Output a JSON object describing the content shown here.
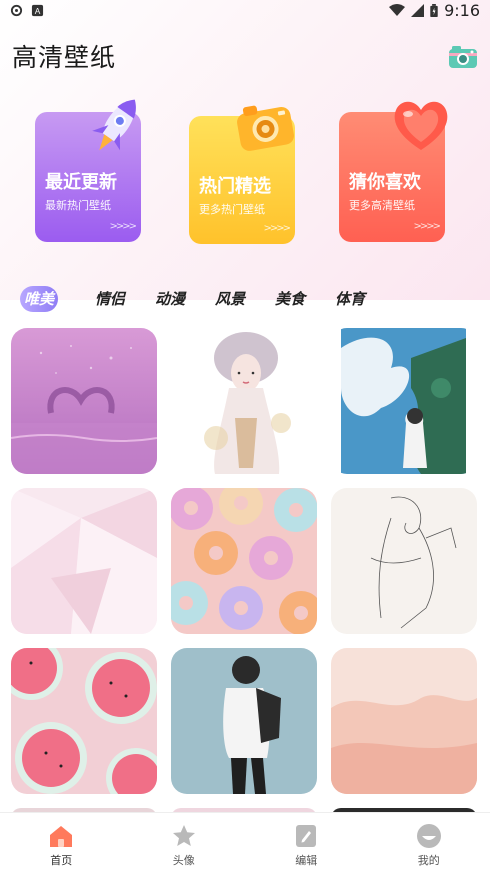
{
  "status_bar": {
    "time": "9:16",
    "left_icons": [
      "settings-icon",
      "app-a-icon"
    ],
    "right_icons": [
      "wifi-icon",
      "signal-icon",
      "battery-icon"
    ]
  },
  "header": {
    "title": "高清壁纸",
    "action_icon": "camera-icon"
  },
  "feature_cards": [
    {
      "title": "最近更新",
      "subtitle": "最新热门壁纸",
      "arrows": ">>>>",
      "icon": "rocket-icon",
      "color": "#a26bf2"
    },
    {
      "title": "热门精选",
      "subtitle": "更多热门壁纸",
      "arrows": ">>>>",
      "icon": "camera-icon",
      "color": "#ffc72e"
    },
    {
      "title": "猜你喜欢",
      "subtitle": "更多高清壁纸",
      "arrows": ">>>>",
      "icon": "heart-icon",
      "color": "#ff6a55"
    }
  ],
  "tabs": [
    "唯美",
    "情侣",
    "动漫",
    "风景",
    "美食",
    "体育"
  ],
  "active_tab": "唯美",
  "bottom_nav": [
    {
      "label": "首页",
      "icon": "home-icon",
      "active": true
    },
    {
      "label": "头像",
      "icon": "star-icon",
      "active": false
    },
    {
      "label": "编辑",
      "icon": "edit-icon",
      "active": false
    },
    {
      "label": "我的",
      "icon": "profile-icon",
      "active": false
    }
  ]
}
